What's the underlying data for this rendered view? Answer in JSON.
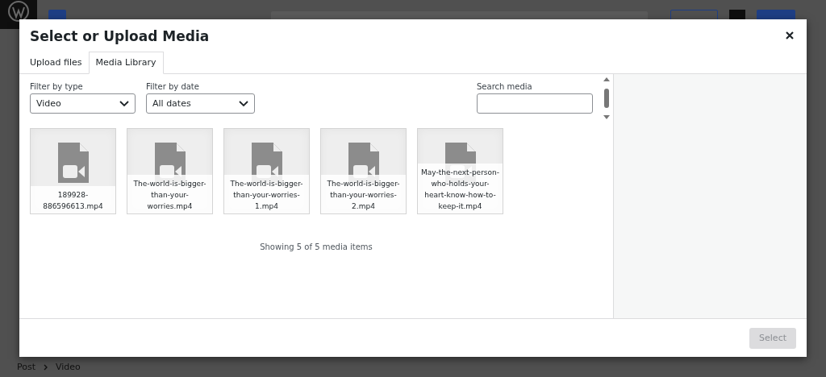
{
  "editor": {
    "breadcrumb": [
      "Post",
      "Video"
    ]
  },
  "modal": {
    "title": "Select or Upload Media",
    "tabs": [
      {
        "label": "Upload files",
        "selected": false
      },
      {
        "label": "Media Library",
        "selected": true
      }
    ],
    "filters": [
      {
        "label": "Filter by type",
        "value": "Video"
      },
      {
        "label": "Filter by date",
        "value": "All dates"
      }
    ],
    "search": {
      "label": "Search media"
    },
    "items": [
      {
        "filename": "189928-886596613.mp4"
      },
      {
        "filename": "The-world-is-bigger-than-your-worries.mp4"
      },
      {
        "filename": "The-world-is-bigger-than-your-worries-1.mp4"
      },
      {
        "filename": "The-world-is-bigger-than-your-worries-2.mp4"
      },
      {
        "filename": "May-the-next-person-who-holds-your-heart-know-how-to-keep-it.mp4"
      }
    ],
    "count": "Showing 5 of 5 media items",
    "select_button": {
      "label": "Select",
      "disabled": true
    }
  }
}
